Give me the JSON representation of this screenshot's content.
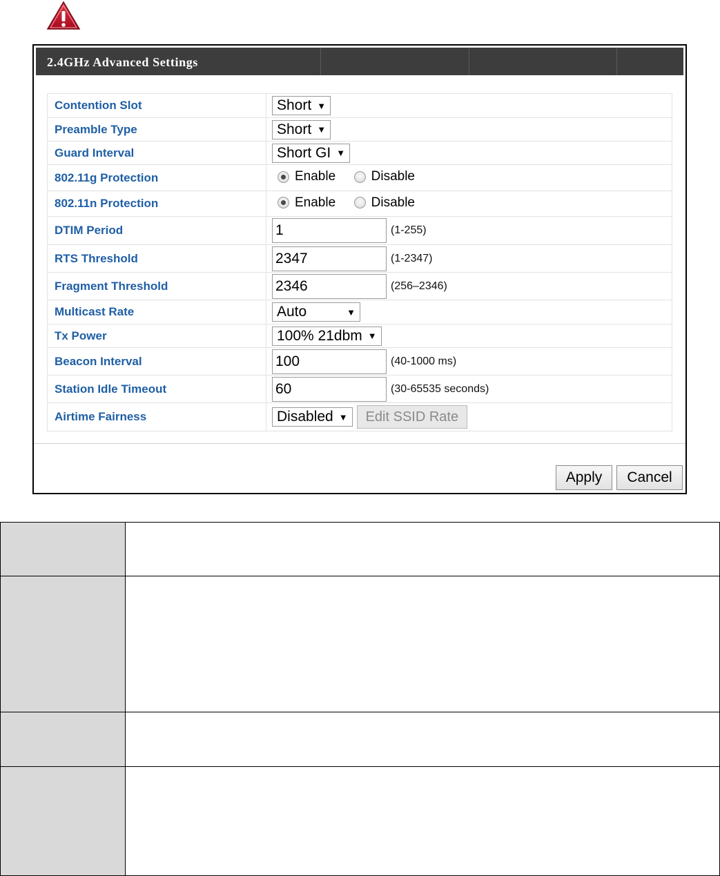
{
  "panel": {
    "title": "2.4GHz Advanced Settings"
  },
  "settings": [
    {
      "label": "Contention Slot",
      "type": "select",
      "value": "Short"
    },
    {
      "label": "Preamble Type",
      "type": "select",
      "value": "Short"
    },
    {
      "label": "Guard Interval",
      "type": "select",
      "value": "Short GI"
    },
    {
      "label": "802.11g Protection",
      "type": "radio",
      "options": [
        "Enable",
        "Disable"
      ],
      "selected": "Enable"
    },
    {
      "label": "802.11n Protection",
      "type": "radio",
      "options": [
        "Enable",
        "Disable"
      ],
      "selected": "Enable"
    },
    {
      "label": "DTIM Period",
      "type": "text",
      "value": "1",
      "range": "(1-255)"
    },
    {
      "label": "RTS Threshold",
      "type": "text",
      "value": "2347",
      "range": "(1-2347)"
    },
    {
      "label": "Fragment Threshold",
      "type": "text",
      "value": "2346",
      "range": "(256–2346)"
    },
    {
      "label": "Multicast Rate",
      "type": "select",
      "value": "Auto"
    },
    {
      "label": "Tx Power",
      "type": "select",
      "value": "100% 21dbm"
    },
    {
      "label": "Beacon Interval",
      "type": "text",
      "value": "100",
      "range": "(40-1000 ms)"
    },
    {
      "label": "Station Idle Timeout",
      "type": "text",
      "value": "60",
      "range": "(30-65535 seconds)"
    },
    {
      "label": "Airtime Fairness",
      "type": "select",
      "value": "Disabled",
      "extra_button": "Edit SSID Rate"
    }
  ],
  "buttons": {
    "apply": "Apply",
    "cancel": "Cancel"
  },
  "icons": {
    "warning": "warning-triangle-icon"
  },
  "colors": {
    "header_bg": "#3d3d3d",
    "label_text": "#1f5fa5",
    "warning_red": "#c8102e"
  }
}
